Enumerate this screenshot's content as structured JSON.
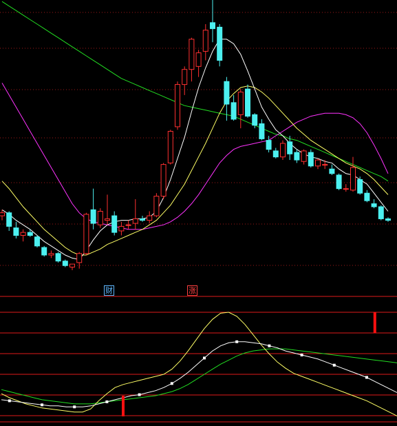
{
  "colors": {
    "background": "#000000",
    "grid": "#a01818",
    "panel_line": "#e01a1a",
    "candle_up": "#ff3030",
    "candle_down": "#4cf0f0",
    "ma_short": "#ffffff",
    "ma_mid": "#ffff66",
    "ma_long": "#ff33ff",
    "ma_trend": "#22dd22",
    "signal_bar": "#ff1010"
  },
  "event_tags": [
    {
      "label": "财",
      "color": "#5fb7ff"
    },
    {
      "label": "涨",
      "color": "#ff4040"
    }
  ],
  "candles": [
    [
      17.2,
      17.6,
      16.9,
      17.4
    ],
    [
      17.4,
      17.5,
      16.2,
      16.5
    ],
    [
      16.4,
      16.8,
      15.7,
      15.9
    ],
    [
      15.9,
      16.3,
      15.5,
      16.1
    ],
    [
      16.1,
      16.3,
      15.8,
      15.9
    ],
    [
      15.8,
      15.9,
      15.1,
      15.2
    ],
    [
      15.1,
      15.2,
      14.5,
      14.6
    ],
    [
      14.6,
      14.9,
      14.4,
      14.7
    ],
    [
      14.7,
      14.8,
      14.1,
      14.2
    ],
    [
      14.2,
      14.3,
      13.8,
      13.9
    ],
    [
      13.8,
      14.0,
      13.6,
      14.0
    ],
    [
      14.1,
      14.8,
      13.7,
      14.7
    ],
    [
      14.7,
      17.4,
      14.6,
      17.3
    ],
    [
      17.6,
      19.0,
      16.3,
      16.7
    ],
    [
      16.6,
      17.7,
      16.4,
      17.5
    ],
    [
      16.9,
      18.6,
      16.6,
      17.0
    ],
    [
      17.2,
      17.5,
      15.9,
      16.1
    ],
    [
      16.2,
      16.8,
      15.9,
      16.5
    ],
    [
      16.6,
      16.9,
      16.3,
      16.6
    ],
    [
      16.7,
      18.3,
      16.3,
      17.0
    ],
    [
      17.0,
      17.2,
      16.8,
      16.9
    ],
    [
      16.9,
      17.5,
      16.7,
      17.2
    ],
    [
      17.2,
      18.7,
      17.1,
      18.5
    ],
    [
      18.5,
      20.7,
      18.3,
      20.6
    ],
    [
      20.7,
      22.9,
      20.6,
      22.8
    ],
    [
      23.1,
      26.1,
      22.9,
      25.9
    ],
    [
      25.9,
      27.1,
      25.2,
      26.9
    ],
    [
      26.9,
      29.0,
      26.1,
      28.9
    ],
    [
      27.1,
      28.2,
      26.4,
      28.0
    ],
    [
      28.1,
      29.9,
      27.5,
      29.5
    ],
    [
      30.0,
      31.6,
      28.7,
      29.6
    ],
    [
      29.7,
      29.9,
      27.1,
      27.5
    ],
    [
      26.1,
      26.4,
      23.5,
      24.6
    ],
    [
      24.7,
      25.2,
      23.5,
      23.6
    ],
    [
      23.9,
      25.6,
      23.0,
      25.4
    ],
    [
      25.6,
      25.9,
      23.7,
      23.8
    ],
    [
      23.9,
      24.0,
      23.0,
      23.2
    ],
    [
      23.3,
      23.6,
      22.2,
      22.3
    ],
    [
      22.2,
      22.5,
      21.4,
      21.6
    ],
    [
      21.5,
      21.7,
      21.0,
      21.1
    ],
    [
      21.1,
      22.2,
      20.9,
      22.0
    ],
    [
      22.1,
      22.5,
      20.9,
      21.3
    ],
    [
      21.4,
      21.6,
      20.7,
      20.9
    ],
    [
      20.8,
      21.6,
      20.6,
      21.5
    ],
    [
      21.4,
      21.6,
      20.4,
      20.5
    ],
    [
      20.5,
      21.0,
      20.3,
      20.9
    ],
    [
      20.6,
      20.9,
      20.3,
      20.6
    ],
    [
      20.3,
      20.6,
      19.9,
      20.0
    ],
    [
      19.9,
      20.0,
      18.9,
      19.0
    ],
    [
      19.0,
      19.3,
      18.8,
      19.0
    ],
    [
      18.9,
      21.1,
      18.8,
      20.4
    ],
    [
      19.6,
      19.8,
      18.6,
      18.7
    ],
    [
      18.7,
      18.9,
      18.1,
      18.2
    ],
    [
      18.0,
      18.3,
      17.7,
      17.8
    ],
    [
      17.8,
      17.9,
      16.9,
      17.0
    ],
    [
      17.0,
      17.1,
      16.8,
      16.9
    ]
  ],
  "ma_lines": {
    "white": [
      17.6,
      17.3,
      16.9,
      16.6,
      16.3,
      15.9,
      15.5,
      15.2,
      14.9,
      14.6,
      14.4,
      14.3,
      14.9,
      15.6,
      16.2,
      16.6,
      16.8,
      16.9,
      16.9,
      17.0,
      17.0,
      17.1,
      17.5,
      18.4,
      19.6,
      21.0,
      22.4,
      24.1,
      25.7,
      27.0,
      28.1,
      28.9,
      28.9,
      28.6,
      27.9,
      26.8,
      25.6,
      24.4,
      23.6,
      22.9,
      22.5,
      22.0,
      21.6,
      21.3,
      21.1,
      21.0,
      20.8,
      20.7,
      20.3,
      20.0,
      19.9,
      19.6,
      19.3,
      18.7,
      18.1,
      17.5
    ],
    "yellow": [
      19.5,
      19.0,
      18.4,
      17.8,
      17.3,
      16.8,
      16.3,
      15.9,
      15.5,
      15.1,
      14.8,
      14.6,
      14.6,
      14.8,
      15.0,
      15.3,
      15.5,
      15.7,
      15.9,
      16.1,
      16.3,
      16.6,
      16.9,
      17.4,
      17.9,
      18.6,
      19.3,
      20.2,
      21.1,
      22.0,
      23.0,
      24.0,
      24.8,
      25.3,
      25.7,
      25.8,
      25.7,
      25.4,
      25.0,
      24.5,
      24.0,
      23.5,
      23.0,
      22.6,
      22.2,
      21.9,
      21.6,
      21.3,
      21.0,
      20.7,
      20.5,
      20.3,
      20.0,
      19.6,
      19.1,
      18.6
    ],
    "magenta": [
      26.0,
      25.2,
      24.4,
      23.6,
      22.8,
      22.0,
      21.2,
      20.4,
      19.6,
      18.8,
      18.0,
      17.4,
      17.0,
      16.8,
      16.7,
      16.6,
      16.5,
      16.4,
      16.3,
      16.3,
      16.3,
      16.4,
      16.5,
      16.6,
      16.8,
      17.1,
      17.5,
      18.0,
      18.6,
      19.3,
      20.0,
      20.7,
      21.2,
      21.6,
      21.8,
      21.9,
      22.0,
      22.1,
      22.2,
      22.5,
      22.8,
      23.1,
      23.4,
      23.6,
      23.8,
      23.9,
      24.0,
      24.0,
      24.0,
      23.9,
      23.7,
      23.3,
      22.7,
      21.9,
      21.0,
      20.0
    ],
    "green": [
      31.4,
      31.1,
      30.8,
      30.5,
      30.2,
      29.9,
      29.6,
      29.3,
      29.0,
      28.7,
      28.4,
      28.1,
      27.8,
      27.5,
      27.2,
      26.9,
      26.6,
      26.3,
      26.1,
      25.9,
      25.7,
      25.5,
      25.3,
      25.1,
      24.9,
      24.7,
      24.5,
      24.4,
      24.3,
      24.2,
      24.1,
      24.0,
      23.9,
      23.8,
      23.6,
      23.4,
      23.2,
      23.0,
      22.8,
      22.6,
      22.5,
      22.3,
      22.2,
      22.0,
      21.8,
      21.6,
      21.4,
      21.2,
      21.0,
      20.8,
      20.6,
      20.4,
      20.2,
      20.0,
      19.8,
      19.5
    ]
  },
  "indicator": {
    "yellow": [
      0.2,
      0.16,
      0.13,
      0.1,
      0.08,
      0.06,
      0.05,
      0.04,
      0.03,
      0.02,
      0.02,
      0.05,
      0.13,
      0.2,
      0.26,
      0.29,
      0.31,
      0.33,
      0.35,
      0.37,
      0.39,
      0.44,
      0.52,
      0.62,
      0.73,
      0.84,
      0.93,
      0.99,
      1.0,
      0.96,
      0.88,
      0.78,
      0.68,
      0.59,
      0.51,
      0.45,
      0.4,
      0.37,
      0.34,
      0.31,
      0.28,
      0.25,
      0.22,
      0.19,
      0.16,
      0.13,
      0.09,
      0.05,
      0.01,
      -0.03
    ],
    "white": [
      0.14,
      0.13,
      0.12,
      0.11,
      0.1,
      0.09,
      0.08,
      0.08,
      0.07,
      0.07,
      0.07,
      0.08,
      0.1,
      0.12,
      0.14,
      0.16,
      0.18,
      0.19,
      0.21,
      0.23,
      0.26,
      0.3,
      0.35,
      0.41,
      0.48,
      0.55,
      0.62,
      0.67,
      0.7,
      0.71,
      0.71,
      0.7,
      0.69,
      0.67,
      0.65,
      0.62,
      0.6,
      0.58,
      0.56,
      0.54,
      0.51,
      0.48,
      0.45,
      0.42,
      0.39,
      0.36,
      0.32,
      0.28,
      0.24,
      0.2
    ],
    "green": [
      0.24,
      0.22,
      0.2,
      0.18,
      0.16,
      0.14,
      0.13,
      0.12,
      0.11,
      0.1,
      0.1,
      0.1,
      0.11,
      0.12,
      0.13,
      0.14,
      0.15,
      0.16,
      0.17,
      0.18,
      0.2,
      0.22,
      0.25,
      0.29,
      0.34,
      0.39,
      0.44,
      0.49,
      0.53,
      0.57,
      0.6,
      0.62,
      0.63,
      0.64,
      0.64,
      0.64,
      0.63,
      0.62,
      0.61,
      0.6,
      0.59,
      0.58,
      0.57,
      0.56,
      0.55,
      0.54,
      0.53,
      0.52,
      0.51,
      0.5
    ],
    "signals": [
      15,
      46
    ]
  }
}
